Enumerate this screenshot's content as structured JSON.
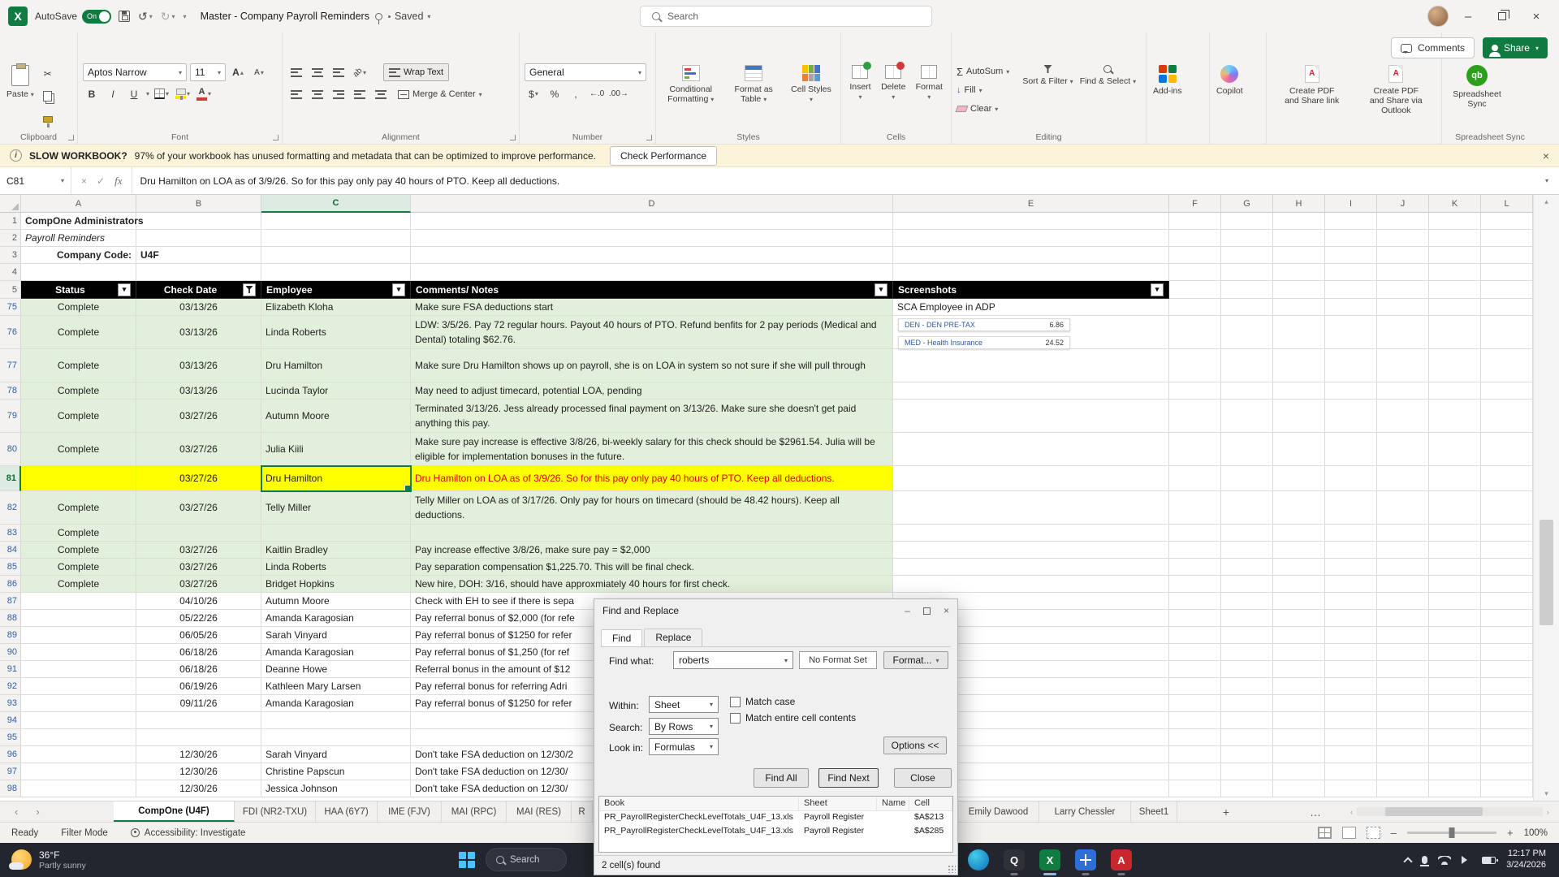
{
  "colors": {
    "excel_green": "#107C41",
    "share_green": "#0F7B41",
    "fill_green": "#E2EFDA",
    "fill_yellow": "#FFFF00",
    "note_red": "#E00000",
    "header_black": "#000000",
    "taskbar_dark": "#23262E"
  },
  "icons": {
    "caret": "▾",
    "undo": "↺",
    "redo": "↻",
    "cut": "✂",
    "close": "×",
    "minimize": "–",
    "check": "✓",
    "sigma": "Σ",
    "dollar": "$",
    "percent": "%",
    "comma": ",",
    "dec_inc": "←.0",
    "dec_dec": ".00→",
    "bold": "B",
    "italic": "I",
    "underline": "U",
    "fx": "fx",
    "a": "A",
    "up": "▴",
    "chev_l": "‹",
    "chev_r": "›",
    "plus": "+",
    "ellipsis": "…",
    "info": "i",
    "x": "X",
    "q": "Q",
    "qb": "qb",
    "pdf_a": "A",
    "arrow_down": "↓",
    "up_small": "▴",
    "down_small": "▾"
  },
  "titlebar": {
    "autosave_label": "AutoSave",
    "autosave_state": "On",
    "doc_title": "Master - Company Payroll Reminders",
    "saved": "Saved",
    "search": "Search",
    "comments": "Comments",
    "share": "Share"
  },
  "ribbon": {
    "paste": "Paste",
    "font_name": "Aptos Narrow",
    "font_size": "11",
    "wrap": "Wrap Text",
    "merge": "Merge & Center",
    "number_fmt": "General",
    "cond": "Conditional Formatting",
    "fmt_table": "Format as Table",
    "cell_styles": "Cell Styles",
    "insert": "Insert",
    "del": "Delete",
    "format": "Format",
    "autosum": "AutoSum",
    "fill": "Fill",
    "clear": "Clear",
    "sort": "Sort & Filter",
    "find": "Find & Select",
    "addins": "Add-ins",
    "copilot": "Copilot",
    "pdf1": "Create PDF and Share link",
    "pdf2": "Create PDF and Share via Outlook",
    "sync": "Spreadsheet Sync",
    "groups": {
      "clipboard": "Clipboard",
      "font": "Font",
      "align": "Alignment",
      "number": "Number",
      "styles": "Styles",
      "cells": "Cells",
      "editing": "Editing",
      "sync": "Spreadsheet Sync"
    }
  },
  "warn": {
    "bold": "SLOW WORKBOOK?",
    "text": "97% of your workbook has unused formatting and metadata that can be optimized to improve performance.",
    "btn": "Check Performance"
  },
  "fbar": {
    "ref": "C81",
    "formula": "Dru Hamilton on LOA as of 3/9/26. So for this pay only pay 40 hours of PTO. Keep all deductions."
  },
  "grid": {
    "col_letters": [
      "A",
      "B",
      "C",
      "D",
      "E",
      "F",
      "G",
      "H",
      "I",
      "J",
      "K",
      "L"
    ],
    "selected_col": "C",
    "selected_row": "81",
    "title": "CompOne Administrators",
    "subtitle": "Payroll Reminders",
    "company_label": "Company Code:",
    "company_code": "U4F",
    "headers": [
      "Status",
      "Check Date",
      "Employee",
      "Comments/ Notes",
      "Screenshots"
    ],
    "filtered_index": 1,
    "shot_title": "SCA Employee in ADP",
    "chips": [
      {
        "label": "DEN - DEN PRE-TAX",
        "value": "6.86"
      },
      {
        "label": "MED - Health Insurance",
        "value": "24.52"
      }
    ],
    "rows": [
      {
        "n": "75",
        "fill": "g",
        "status": "Complete",
        "date": "03/13/26",
        "emp": "Elizabeth Kloha",
        "notes": "Make sure FSA deductions start"
      },
      {
        "n": "76",
        "fill": "g",
        "status": "Complete",
        "date": "03/13/26",
        "emp": "Linda Roberts",
        "notes": "LDW: 3/5/26. Pay 72 regular hours. Payout 40 hours of PTO. Refund benfits for 2 pay periods (Medical and Dental) totaling $62.76."
      },
      {
        "n": "77",
        "fill": "g",
        "status": "Complete",
        "date": "03/13/26",
        "emp": "Dru Hamilton",
        "notes": "Make sure Dru Hamilton shows up on payroll, she is on LOA in system so not sure if she will pull through"
      },
      {
        "n": "78",
        "fill": "g",
        "status": "Complete",
        "date": "03/13/26",
        "emp": "Lucinda Taylor",
        "notes": "May need to adjust timecard, potential LOA, pending"
      },
      {
        "n": "79",
        "fill": "g",
        "status": "Complete",
        "date": "03/27/26",
        "emp": "Autumn Moore",
        "notes": "Terminated 3/13/26. Jess already processed final payment on 3/13/26. Make sure she doesn't get paid anything this pay."
      },
      {
        "n": "80",
        "fill": "g",
        "status": "Complete",
        "date": "03/27/26",
        "emp": "Julia Kiili",
        "notes": "Make sure pay increase is effective 3/8/26, bi-weekly salary for this check should be $2961.54. Julia will be eligible for implementation bonuses in the future."
      },
      {
        "n": "81",
        "fill": "y",
        "status": "",
        "date": "03/27/26",
        "emp": "Dru Hamilton",
        "notes": "Dru Hamilton on LOA as of 3/9/26. So for this pay only pay 40 hours of PTO. Keep all deductions.",
        "red": true,
        "sel": true
      },
      {
        "n": "82",
        "fill": "g",
        "status": "Complete",
        "date": "03/27/26",
        "emp": "Telly Miller",
        "notes": "Telly Miller on LOA as of 3/17/26. Only pay for hours on timecard (should be 48.42 hours). Keep all deductions."
      },
      {
        "n": "83",
        "fill": "g",
        "status": "Complete",
        "date": "",
        "emp": "",
        "notes": ""
      },
      {
        "n": "84",
        "fill": "g",
        "status": "Complete",
        "date": "03/27/26",
        "emp": "Kaitlin Bradley",
        "notes": "Pay increase effective 3/8/26, make sure pay = $2,000"
      },
      {
        "n": "85",
        "fill": "g",
        "status": "Complete",
        "date": "03/27/26",
        "emp": "Linda Roberts",
        "notes": "Pay separation compensation $1,225.70. This will be final check."
      },
      {
        "n": "86",
        "fill": "g",
        "status": "Complete",
        "date": "03/27/26",
        "emp": "Bridget Hopkins",
        "notes": "New hire, DOH: 3/16, should have approxmiately 40 hours for first check."
      },
      {
        "n": "87",
        "fill": "",
        "status": "",
        "date": "04/10/26",
        "emp": "Autumn Moore",
        "notes": "Check with EH to see if there is sepa"
      },
      {
        "n": "88",
        "fill": "",
        "status": "",
        "date": "05/22/26",
        "emp": "Amanda Karagosian",
        "notes": "Pay referral bonus of $2,000 (for refe"
      },
      {
        "n": "89",
        "fill": "",
        "status": "",
        "date": "06/05/26",
        "emp": "Sarah Vinyard",
        "notes": "Pay referral bonus of $1250 for refer"
      },
      {
        "n": "90",
        "fill": "",
        "status": "",
        "date": "06/18/26",
        "emp": "Amanda Karagosian",
        "notes": "Pay referral bonus of $1,250 (for ref"
      },
      {
        "n": "91",
        "fill": "",
        "status": "",
        "date": "06/18/26",
        "emp": "Deanne Howe",
        "notes": "Referral bonus in the amount of $12"
      },
      {
        "n": "92",
        "fill": "",
        "status": "",
        "date": "06/19/26",
        "emp": "Kathleen Mary Larsen",
        "notes": "Pay referral bonus for referring Adri"
      },
      {
        "n": "93",
        "fill": "",
        "status": "",
        "date": "09/11/26",
        "emp": "Amanda Karagosian",
        "notes": "Pay referral bonus of $1250 for refer"
      },
      {
        "n": "94",
        "fill": "",
        "status": "",
        "date": "",
        "emp": "",
        "notes": ""
      },
      {
        "n": "95",
        "fill": "",
        "status": "",
        "date": "",
        "emp": "",
        "notes": ""
      },
      {
        "n": "96",
        "fill": "",
        "status": "",
        "date": "12/30/26",
        "emp": "Sarah Vinyard",
        "notes": "Don't take FSA deduction on 12/30/2"
      },
      {
        "n": "97",
        "fill": "",
        "status": "",
        "date": "12/30/26",
        "emp": "Christine Papscun",
        "notes": "Don't take FSA deduction on 12/30/"
      },
      {
        "n": "98",
        "fill": "",
        "status": "",
        "date": "12/30/26",
        "emp": "Jessica Johnson",
        "notes": "Don't take FSA deduction on 12/30/"
      }
    ]
  },
  "dialog": {
    "title": "Find and Replace",
    "tab_find": "Find",
    "tab_replace": "Replace",
    "find_what": "Find what:",
    "find_value": "roberts",
    "no_format": "No Format Set",
    "format_btn": "Format...",
    "within": "Within:",
    "within_v": "Sheet",
    "search": "Search:",
    "search_v": "By Rows",
    "look": "Look in:",
    "look_v": "Formulas",
    "match_case": "Match case",
    "match_entire": "Match entire cell contents",
    "options": "Options <<",
    "find_all": "Find All",
    "find_next": "Find Next",
    "close_btn": "Close",
    "cols": [
      "Book",
      "Sheet",
      "Name",
      "Cell"
    ],
    "results": [
      {
        "book": "PR_PayrollRegisterCheckLevelTotals_U4F_13.xls",
        "sheet": "Payroll Register",
        "name": "",
        "cell": "$A$213"
      },
      {
        "book": "PR_PayrollRegisterCheckLevelTotals_U4F_13.xls",
        "sheet": "Payroll Register",
        "name": "",
        "cell": "$A$285"
      }
    ],
    "status": "2 cell(s) found"
  },
  "sheet_tabs": {
    "tabs": [
      "CompOne (U4F)",
      "FDI (NR2-TXU)",
      "HAA (6Y7)",
      "IME (FJV)",
      "MAI (RPC)",
      "MAI (RES)",
      "R",
      "Emily Dawood",
      "Larry Chessler",
      "Sheet1"
    ],
    "active_index": 0
  },
  "status_bar": {
    "ready": "Ready",
    "filter": "Filter Mode",
    "access": "Accessibility: Investigate",
    "zoom": "100%"
  },
  "taskbar": {
    "temp": "36°F",
    "desc": "Partly sunny",
    "search": "Search",
    "time": "12:17 PM",
    "date": "3/24/2026"
  }
}
